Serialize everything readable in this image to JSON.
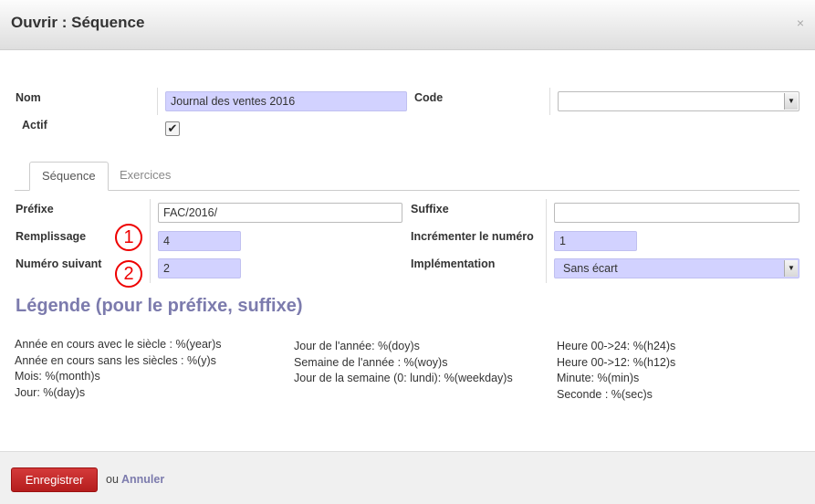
{
  "dialog": {
    "title": "Ouvrir : Séquence",
    "close_glyph": "×"
  },
  "form": {
    "nom_label": "Nom",
    "nom_value": "Journal des ventes 2016",
    "code_label": "Code",
    "code_value": "",
    "actif_label": "Actif",
    "actif_checked": true
  },
  "tabs": [
    {
      "label": "Séquence",
      "active": true
    },
    {
      "label": "Exercices",
      "active": false
    }
  ],
  "sequence": {
    "prefixe_label": "Préfixe",
    "prefixe_value": "FAC/2016/",
    "suffixe_label": "Suffixe",
    "suffixe_value": "",
    "remplissage_label": "Remplissage",
    "remplissage_value": "4",
    "increment_label": "Incrémenter le numéro",
    "increment_value": "1",
    "numero_label": "Numéro suivant",
    "numero_value": "2",
    "implementation_label": "Implémentation",
    "implementation_value": "Sans écart"
  },
  "annotations": [
    "1",
    "2"
  ],
  "legend": {
    "title": "Légende (pour le préfixe, suffixe)",
    "col1": [
      "Année en cours avec le siècle : %(year)s",
      "Année en cours sans les siècles : %(y)s",
      "Mois: %(month)s",
      "Jour: %(day)s"
    ],
    "col2": [
      "Jour de l'année: %(doy)s",
      "Semaine de l'année : %(woy)s",
      "Jour de la semaine (0: lundi): %(weekday)s"
    ],
    "col3": [
      "Heure 00->24: %(h24)s",
      "Heure 00->12: %(h12)s",
      "Minute: %(min)s",
      "Seconde : %(sec)s"
    ]
  },
  "footer": {
    "save_label": "Enregistrer",
    "or_label": "ou",
    "cancel_label": "Annuler"
  },
  "colors": {
    "required_field": "#d2d2ff",
    "accent": "#7c7bad",
    "save_button": "#c12a2a",
    "annotation": "#e00000"
  }
}
